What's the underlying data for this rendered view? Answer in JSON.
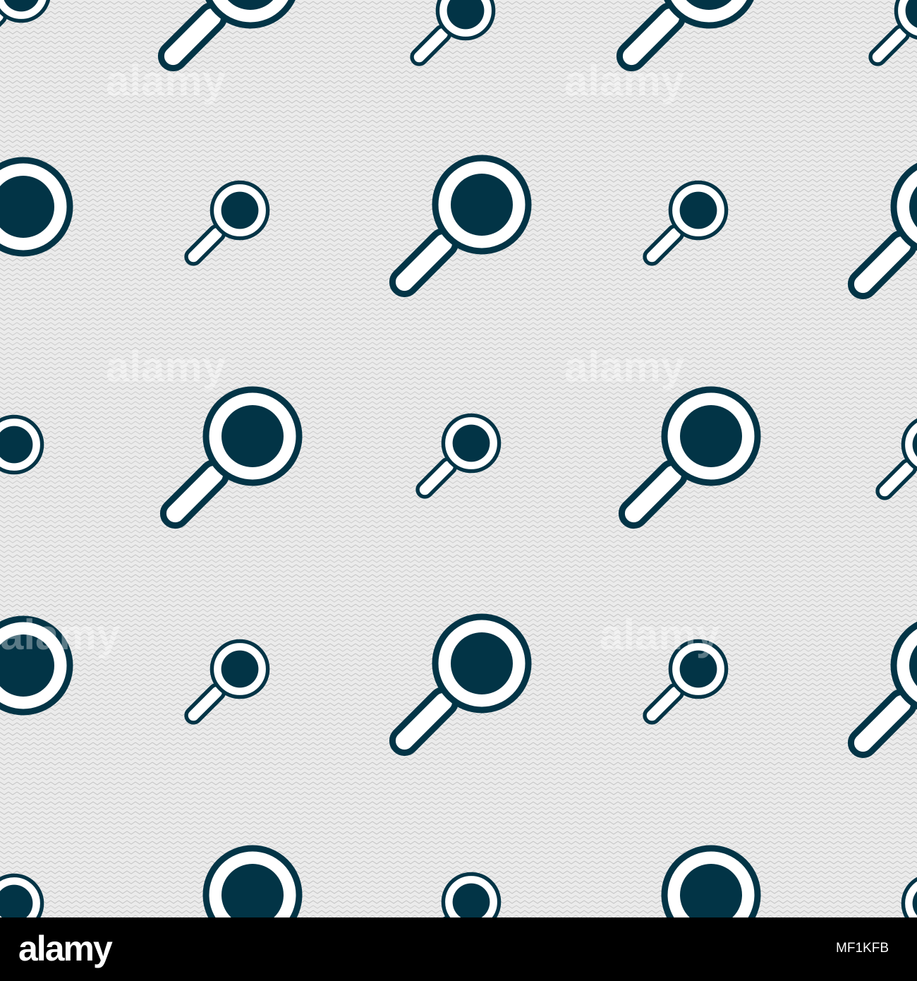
{
  "image": {
    "subject": "magnifier-icon",
    "pattern": "seamless",
    "colors": {
      "background": "#ebebeb",
      "zigzag": "#c8c8c8",
      "icon": "#023446",
      "outline_gap": "#ffffff",
      "footer_bg": "#000000",
      "footer_text": "#ffffff"
    }
  },
  "watermark": {
    "brand": "alamy"
  },
  "footer": {
    "brand": "alamy",
    "image_id": "MF1KFB"
  }
}
